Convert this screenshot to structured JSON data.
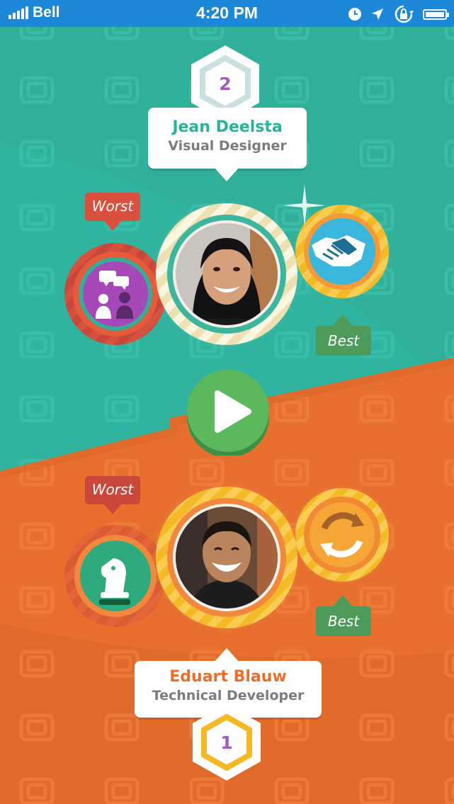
{
  "status_bar": {
    "carrier": "Bell",
    "time": "4:20 PM",
    "icons": [
      "signal-icon",
      "alarm-icon",
      "location-icon",
      "orientation-lock-icon",
      "battery-icon"
    ]
  },
  "player_top": {
    "rank": "2",
    "name": "Jean Deelsta",
    "role": "Visual Designer",
    "worst_label": "Worst",
    "best_label": "Best",
    "worst_icon": "conversation-icon",
    "best_icon": "handshake-icon",
    "name_color": "#2bb29a"
  },
  "play_button": {
    "icon": "play-icon",
    "color": "#5cb85c"
  },
  "player_bottom": {
    "rank": "1",
    "name": "Eduart Blauw",
    "role": "Technical Developer",
    "worst_label": "Worst",
    "best_label": "Best",
    "worst_icon": "chess-knight-icon",
    "best_icon": "refresh-icon",
    "name_color": "#e8702f"
  },
  "colors": {
    "teal": "#31b49f",
    "orange": "#e8702f",
    "status_bar": "#1e88d8",
    "worst_tag": "#d9503f",
    "best_tag": "#4d9a5a",
    "gold": "#f4b927",
    "purple_rank": "#a35ab8"
  }
}
